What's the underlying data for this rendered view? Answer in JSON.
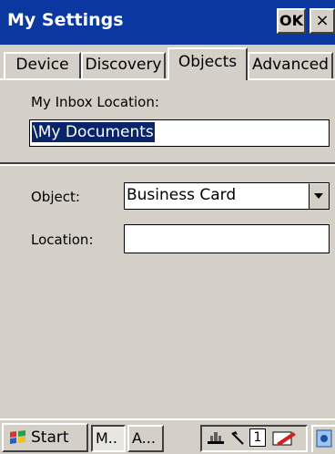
{
  "window": {
    "title": "My Settings",
    "ok_label": "OK",
    "close_label": "×"
  },
  "tabs": [
    {
      "label": "Device"
    },
    {
      "label": "Discovery"
    },
    {
      "label": "Objects",
      "active": true
    },
    {
      "label": "Advanced"
    }
  ],
  "inbox": {
    "label": "My Inbox Location:",
    "value": "\\My Documents"
  },
  "object": {
    "label": "Object:",
    "selected": "Business Card"
  },
  "location": {
    "label": "Location:",
    "value": ""
  },
  "taskbar": {
    "start_label": "Start",
    "tasks": [
      {
        "label": "M..",
        "pressed": true
      },
      {
        "label": "A...",
        "pressed": false
      }
    ],
    "tray_number": "1"
  },
  "colors": {
    "titlebar": "#0a38a0",
    "selection": "#0a246a",
    "face": "#d4d0c8"
  }
}
